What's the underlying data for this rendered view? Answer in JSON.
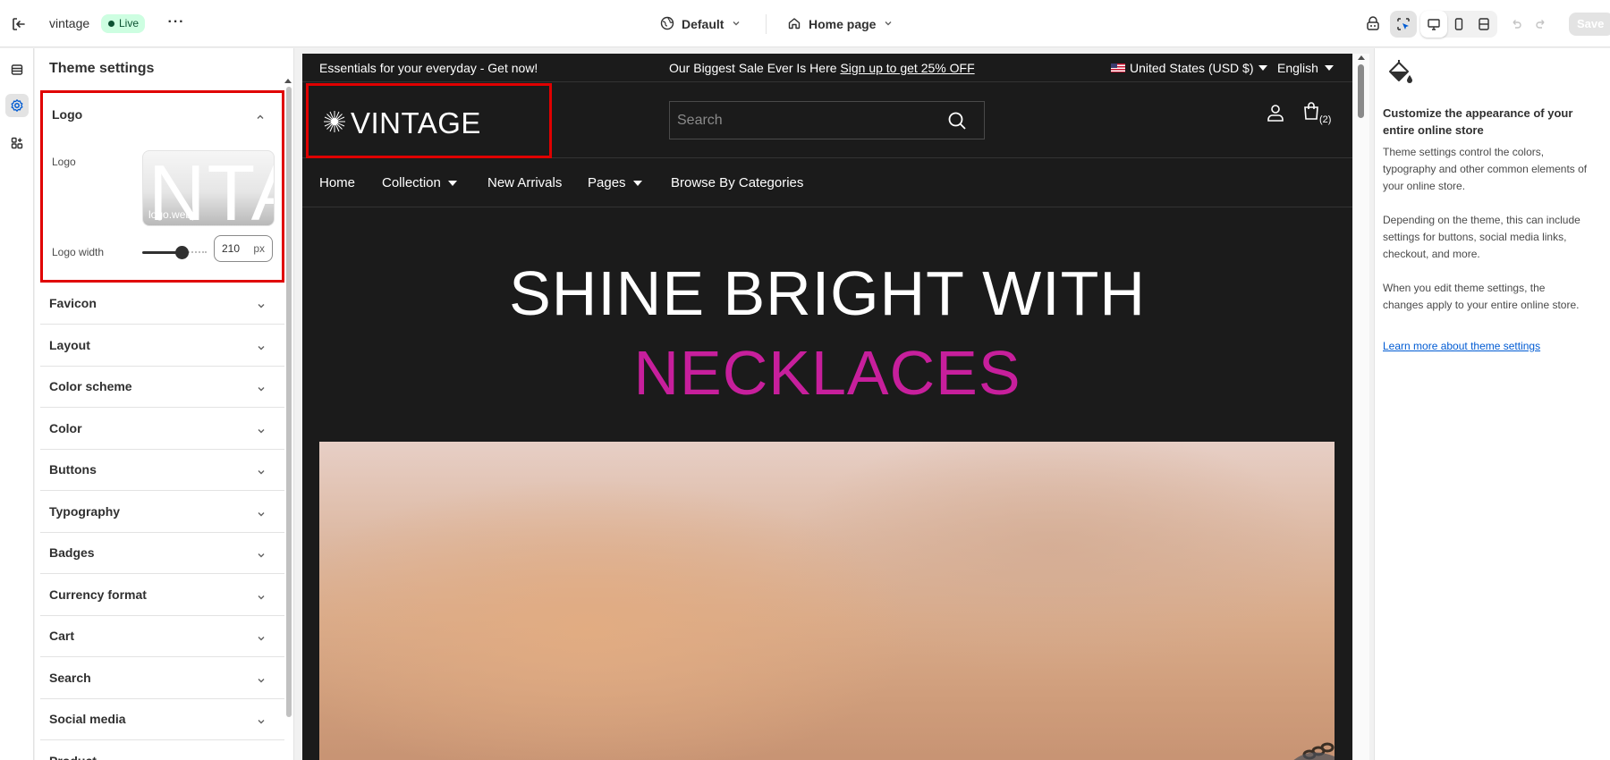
{
  "topbar": {
    "store_name": "vintage",
    "status_badge": "Live",
    "theme_name": "Default",
    "page_name": "Home page",
    "save_label": "Save"
  },
  "panel": {
    "title": "Theme settings",
    "logo_section": {
      "heading": "Logo",
      "logo_label": "Logo",
      "logo_file": "logo.webp",
      "logo_width_label": "Logo width",
      "logo_width_value": "210",
      "logo_width_unit": "px",
      "logo_width_slider_fraction": 0.6
    },
    "sections": [
      {
        "label": "Favicon"
      },
      {
        "label": "Layout"
      },
      {
        "label": "Color scheme"
      },
      {
        "label": "Color"
      },
      {
        "label": "Buttons"
      },
      {
        "label": "Typography"
      },
      {
        "label": "Badges"
      },
      {
        "label": "Currency format"
      },
      {
        "label": "Cart"
      },
      {
        "label": "Search"
      },
      {
        "label": "Social media"
      },
      {
        "label": "Product"
      }
    ]
  },
  "store": {
    "announcement_left": "Essentials for your everyday - Get now!",
    "announcement_mid": "Our Biggest Sale Ever Is Here ",
    "announcement_link": "Sign up to get 25% OFF",
    "country": "United States (USD $)",
    "language": "English",
    "logo_text": "VINTAGE",
    "search_placeholder": "Search",
    "cart_count": "(2)",
    "nav": [
      "Home",
      "Collection",
      "New Arrivals",
      "Pages",
      "Browse By Categories"
    ],
    "hero_line1": "SHINE BRIGHT WITH",
    "hero_line2": "NECKLACES",
    "hero_line2_color": "#c71f9c"
  },
  "help": {
    "title": "Customize the appearance of your entire online store",
    "p1": "Theme settings control the colors, typography and other common elements of your online store.",
    "p2": "Depending on the theme, this can include settings for buttons, social media links, checkout, and more.",
    "p3": "When you edit theme settings, the changes apply to your entire online store.",
    "link": "Learn more about theme settings"
  },
  "colors": {
    "accent_highlight": "#e00000",
    "live_badge_bg": "#cdfee1",
    "link": "#005bd3"
  },
  "icons": [
    "exit-icon",
    "more-icon",
    "globe-icon",
    "home-icon",
    "chevron-down-icon",
    "inspector-icon",
    "select-icon",
    "desktop-icon",
    "mobile-icon",
    "fullwidth-icon",
    "undo-icon",
    "redo-icon",
    "sections-icon",
    "settings-icon",
    "apps-icon",
    "chevron-up-icon",
    "search-icon",
    "account-icon",
    "cart-icon",
    "paint-bucket-icon"
  ]
}
